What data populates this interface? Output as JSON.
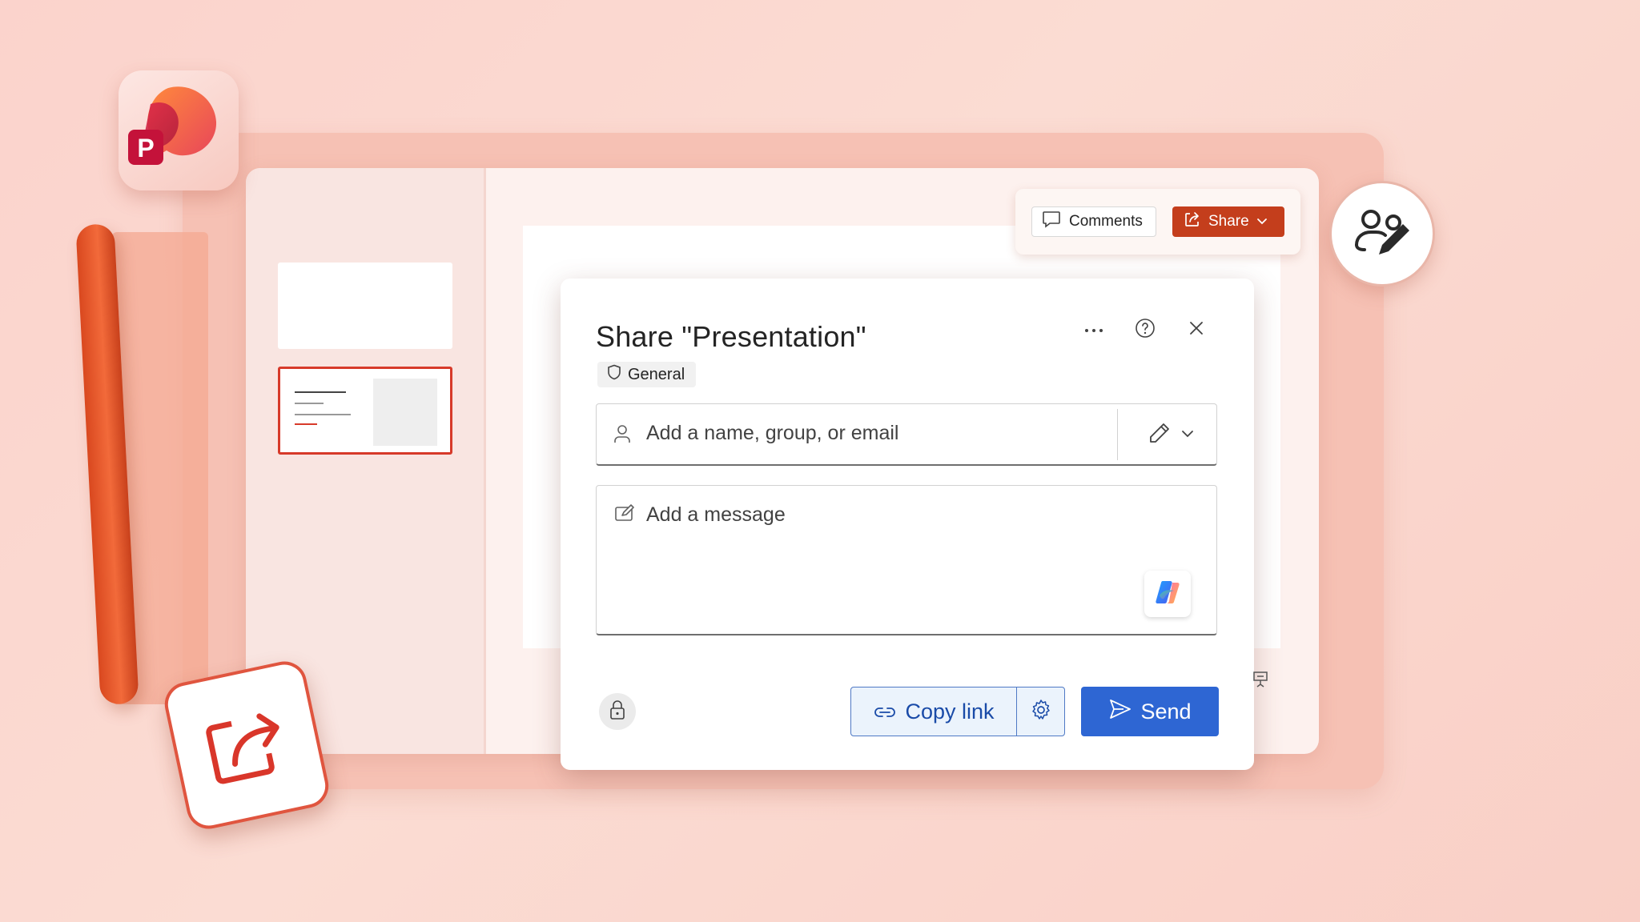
{
  "toolbar": {
    "comments_label": "Comments",
    "share_label": "Share"
  },
  "dialog": {
    "title": "Share \"Presentation\"",
    "sensitivity_label": "General",
    "people_placeholder": "Add a name, group, or email",
    "message_placeholder": "Add a message",
    "copy_link_label": "Copy link",
    "send_label": "Send"
  },
  "icons": {
    "app_logo": "powerpoint-logo",
    "people_edit": "people-edit-icon",
    "share_tile": "share-arrow-icon",
    "comments": "comment-icon",
    "share": "share-icon",
    "more": "more-icon",
    "help": "help-icon",
    "close": "close-icon",
    "shield": "shield-icon",
    "person": "person-icon",
    "pencil": "pencil-icon",
    "chevron": "chevron-down-icon",
    "message": "compose-icon",
    "copilot": "copilot-icon",
    "lock": "lock-icon",
    "link": "link-icon",
    "gear": "gear-icon",
    "send": "send-icon",
    "present": "presenter-icon"
  },
  "colors": {
    "accent_red": "#c43e1c",
    "primary_blue": "#2e66d3",
    "background": "#fbd3cc"
  }
}
